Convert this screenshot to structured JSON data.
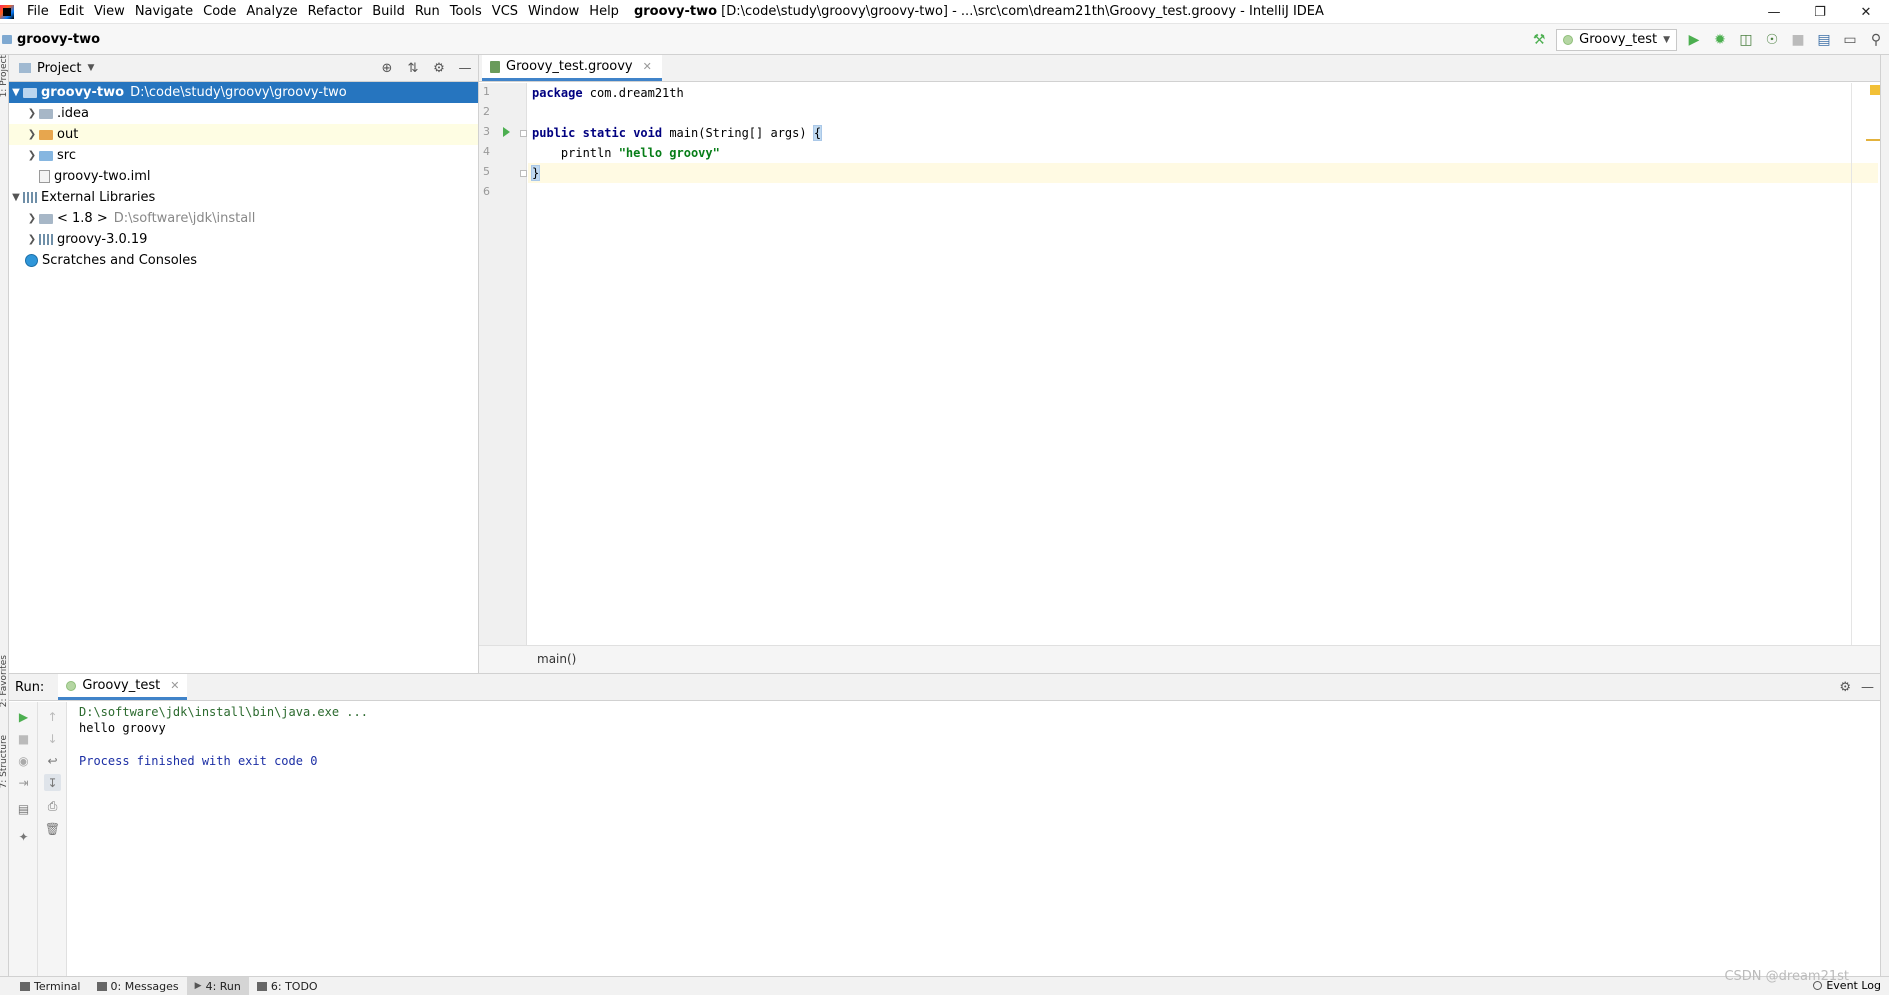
{
  "menu": [
    "File",
    "Edit",
    "View",
    "Navigate",
    "Code",
    "Analyze",
    "Refactor",
    "Build",
    "Run",
    "Tools",
    "VCS",
    "Window",
    "Help"
  ],
  "window_title": {
    "project": "groovy-two",
    "rest": "[D:\\code\\study\\groovy\\groovy-two] - ...\\src\\com\\dream21th\\Groovy_test.groovy - IntelliJ IDEA"
  },
  "window_controls": {
    "minimize": "—",
    "restore": "❐",
    "close": "✕"
  },
  "navbar": {
    "project_name": "groovy-two",
    "run_config": "Groovy_test"
  },
  "left_strip": {
    "project": "1: Project",
    "favorites": "2: Favorites",
    "structure": "7: Structure"
  },
  "project_panel": {
    "title": "Project",
    "tree": [
      {
        "name": "groovy-two",
        "path": "D:\\code\\study\\groovy\\groovy-two",
        "expanded": true,
        "selected": true
      },
      {
        "name": ".idea"
      },
      {
        "name": "out"
      },
      {
        "name": "src"
      },
      {
        "name": "groovy-two.iml"
      },
      {
        "name": "External Libraries",
        "expanded": true
      },
      {
        "name": "< 1.8 >",
        "path": "D:\\software\\jdk\\install"
      },
      {
        "name": "groovy-3.0.19"
      },
      {
        "name": "Scratches and Consoles"
      }
    ]
  },
  "editor": {
    "tab": "Groovy_test.groovy",
    "line_numbers": [
      "1",
      "2",
      "3",
      "4",
      "5",
      "6"
    ],
    "code": {
      "l1_kw": "package",
      "l1_rest": " com.dream21th",
      "l3_kw1": "public",
      "l3_kw2": "static",
      "l3_kw3": "void",
      "l3_rest": " main(String[] args) ",
      "l3_brace": "{",
      "l4_indent": "    println ",
      "l4_str": "\"hello groovy\"",
      "l5_brace": "}"
    },
    "breadcrumb": "main()"
  },
  "run_panel": {
    "label": "Run:",
    "tab": "Groovy_test",
    "console": [
      "D:\\software\\jdk\\install\\bin\\java.exe ...",
      "hello groovy",
      "",
      "Process finished with exit code 0"
    ]
  },
  "bottom_bar": [
    "Terminal",
    "0: Messages",
    "4: Run",
    "6: TODO"
  ],
  "event_log": "Event Log",
  "watermark": "CSDN @dream21st",
  "colors": {
    "selection": "#2675bf",
    "keyword": "#000080",
    "string": "#067d17",
    "current_line": "#fffae3",
    "exit_text": "#1c2fa5"
  }
}
